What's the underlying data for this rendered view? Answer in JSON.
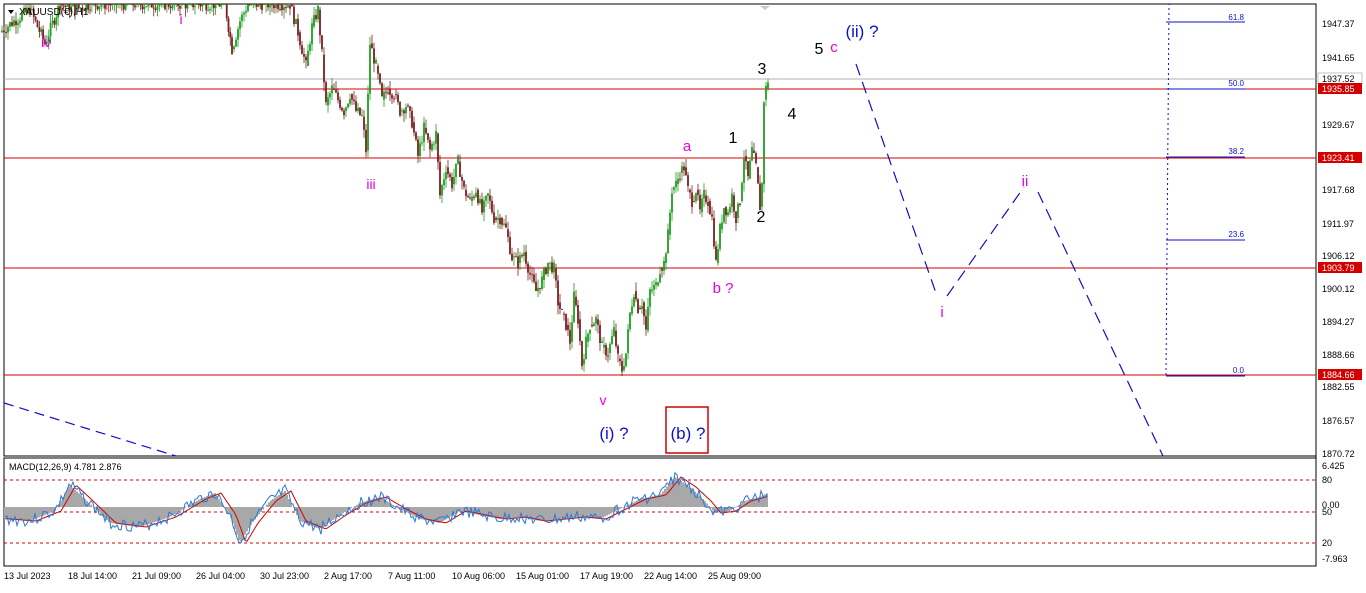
{
  "window": {
    "symbol_label": "XAUUSD(€),H1",
    "dropdown_icon": "triangle-down-icon"
  },
  "colors": {
    "background": "#ffffff",
    "hline": "#d40000",
    "price_tag_fill": "#d40000",
    "bull_candle": "#1f9e1f",
    "bear_candle": "#7a1f1f",
    "wave_magenta": "#e600e6",
    "wave_blue": "#1010c8",
    "wave_black": "#000000",
    "fib": "#1010c8",
    "macd_hist": "#a8a8a8",
    "macd_line": "#2a78d6",
    "macd_signal": "#d40000",
    "grid_dotted": "#d40000"
  },
  "chart_data": [
    {
      "type": "candlestick",
      "title": "XAUUSD(€),H1",
      "ylim": [
        1870.72,
        1951.0
      ],
      "y_ticks": [
        "1947.37",
        "1941.65",
        "1935.85",
        "1929.67",
        "1923.41",
        "1917.68",
        "1911.97",
        "1906.12",
        "1900.12",
        "1894.27",
        "1888.66",
        "1882.55",
        "1876.57",
        "1870.72"
      ],
      "x_ticks": [
        "13 Jul 2023",
        "18 Jul 14:00",
        "21 Jul 09:00",
        "26 Jul 04:00",
        "30 Jul 23:00",
        "2 Aug 17:00",
        "7 Aug 11:00",
        "10 Aug 06:00",
        "15 Aug 01:00",
        "17 Aug 19:00",
        "22 Aug 14:00",
        "25 Aug 09:00"
      ],
      "current_price": "1937.52",
      "price_series": [
        [
          0,
          1946
        ],
        [
          14,
          1948
        ],
        [
          30,
          1950
        ],
        [
          45,
          1944
        ],
        [
          60,
          1951
        ],
        [
          75,
          1950
        ],
        [
          90,
          1951
        ],
        [
          105,
          1951
        ],
        [
          120,
          1951
        ],
        [
          135,
          1951
        ],
        [
          150,
          1951
        ],
        [
          165,
          1951
        ],
        [
          180,
          1951
        ],
        [
          195,
          1951
        ],
        [
          210,
          1951
        ],
        [
          225,
          1951
        ],
        [
          232,
          1943
        ],
        [
          240,
          1948
        ],
        [
          248,
          1951
        ],
        [
          255,
          1951
        ],
        [
          262,
          1951
        ],
        [
          270,
          1951
        ],
        [
          280,
          1951
        ],
        [
          290,
          1951
        ],
        [
          298,
          1946
        ],
        [
          306,
          1940
        ],
        [
          312,
          1947
        ],
        [
          318,
          1950
        ],
        [
          322,
          1942
        ],
        [
          326,
          1933
        ],
        [
          332,
          1936
        ],
        [
          338,
          1934
        ],
        [
          344,
          1932
        ],
        [
          350,
          1935
        ],
        [
          356,
          1932
        ],
        [
          362,
          1931
        ],
        [
          366,
          1925
        ],
        [
          370,
          1944
        ],
        [
          376,
          1940
        ],
        [
          382,
          1934
        ],
        [
          388,
          1936
        ],
        [
          394,
          1935
        ],
        [
          400,
          1932
        ],
        [
          406,
          1933
        ],
        [
          412,
          1930
        ],
        [
          418,
          1924
        ],
        [
          424,
          1929
        ],
        [
          430,
          1925
        ],
        [
          436,
          1928
        ],
        [
          440,
          1917
        ],
        [
          446,
          1922
        ],
        [
          452,
          1919
        ],
        [
          458,
          1923
        ],
        [
          464,
          1918
        ],
        [
          470,
          1916
        ],
        [
          476,
          1918
        ],
        [
          482,
          1914
        ],
        [
          488,
          1917
        ],
        [
          494,
          1913
        ],
        [
          500,
          1913
        ],
        [
          506,
          1911
        ],
        [
          512,
          1906
        ],
        [
          518,
          1905
        ],
        [
          524,
          1907
        ],
        [
          530,
          1903
        ],
        [
          536,
          1900
        ],
        [
          542,
          1902
        ],
        [
          548,
          1905
        ],
        [
          554,
          1904
        ],
        [
          558,
          1898
        ],
        [
          562,
          1896
        ],
        [
          566,
          1894
        ],
        [
          570,
          1891
        ],
        [
          574,
          1899
        ],
        [
          578,
          1895
        ],
        [
          582,
          1887
        ],
        [
          586,
          1891
        ],
        [
          590,
          1894
        ],
        [
          596,
          1895
        ],
        [
          602,
          1890
        ],
        [
          608,
          1889
        ],
        [
          614,
          1893
        ],
        [
          618,
          1888
        ],
        [
          622,
          1886
        ],
        [
          626,
          1889
        ],
        [
          630,
          1896
        ],
        [
          634,
          1900
        ],
        [
          638,
          1897
        ],
        [
          642,
          1898
        ],
        [
          646,
          1893
        ],
        [
          650,
          1900
        ],
        [
          656,
          1901
        ],
        [
          660,
          1904
        ],
        [
          664,
          1905
        ],
        [
          668,
          1910
        ],
        [
          672,
          1918
        ],
        [
          676,
          1919
        ],
        [
          680,
          1921
        ],
        [
          684,
          1922
        ],
        [
          688,
          1918
        ],
        [
          692,
          1916
        ],
        [
          696,
          1918
        ],
        [
          700,
          1914
        ],
        [
          704,
          1917
        ],
        [
          708,
          1916
        ],
        [
          712,
          1913
        ],
        [
          716,
          1905
        ],
        [
          720,
          1911
        ],
        [
          724,
          1915
        ],
        [
          728,
          1914
        ],
        [
          732,
          1917
        ],
        [
          736,
          1913
        ],
        [
          740,
          1916
        ],
        [
          744,
          1924
        ],
        [
          748,
          1920
        ],
        [
          752,
          1925
        ],
        [
          756,
          1922
        ],
        [
          760,
          1915
        ],
        [
          762,
          1919
        ],
        [
          764,
          1934
        ],
        [
          766,
          1936
        ],
        [
          768,
          1937.5
        ]
      ],
      "horizontal_levels": [
        "1935.85",
        "1923.41",
        "1903.79",
        "1884.66"
      ],
      "fibonacci_levels": [
        "61.8",
        "50.0",
        "38.2",
        "23.6",
        "0.0"
      ],
      "wave_labels": {
        "magenta": [
          "iv",
          "i",
          "iii",
          "v",
          "a",
          "b ?",
          "c",
          "i",
          "ii"
        ],
        "black": [
          "1",
          "2",
          "3",
          "4",
          "5"
        ],
        "blue": [
          "(ii) ?",
          "(i) ?",
          "(b) ?"
        ]
      },
      "projection_path": [
        [
          1943,
          1938
        ],
        [
          1910,
          1897
        ],
        [
          1945,
          1898
        ],
        [
          1915,
          1917
        ],
        [
          1965,
          1907
        ],
        [
          1905,
          1872
        ],
        [
          1880,
          1870
        ]
      ]
    },
    {
      "type": "line",
      "title": "MACD(12,26,9) 4.781 2.876",
      "indicator": "MACD(12,26,9)",
      "macd_value": "4.781",
      "signal_value": "2.876",
      "ylim": [
        -7.963,
        6.425
      ],
      "y_ticks": [
        "6.425",
        "80",
        "0.00",
        "50",
        "20",
        "-7.963"
      ],
      "levels": [
        80,
        50,
        20
      ]
    }
  ]
}
